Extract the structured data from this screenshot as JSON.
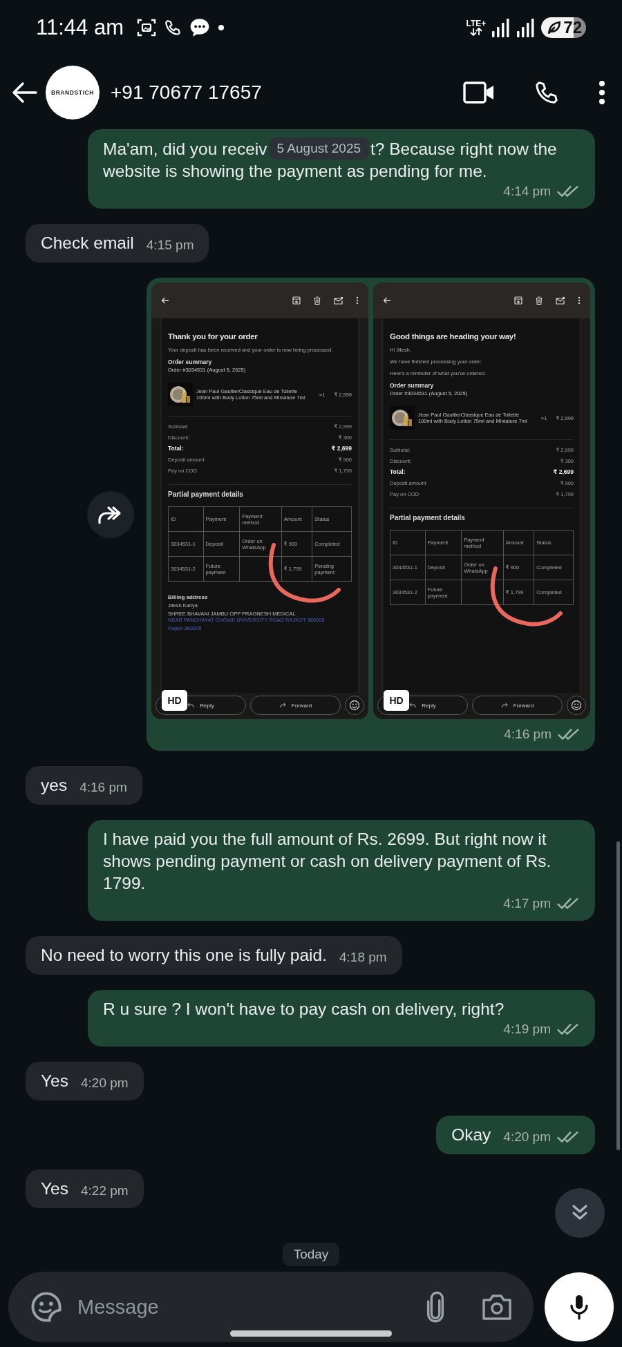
{
  "status_bar": {
    "time": "11:44 am",
    "network": "LTE+",
    "battery": "72"
  },
  "header": {
    "avatar_text": "BRANDSTICH",
    "contact": "+91 70677 17657"
  },
  "date_chip": "5 August 2025",
  "messages": [
    {
      "kind": "covered",
      "outgoing": true,
      "text_start": "Ma'am, did you receiv",
      "text_end": "t? Because right now the",
      "text_next": "website is showing the payment as pending for me.",
      "time": "4:14 pm",
      "delivered": true
    },
    {
      "kind": "text",
      "outgoing": false,
      "text": "Check email",
      "time": "4:15 pm"
    },
    {
      "kind": "images",
      "outgoing": true,
      "time": "4:16 pm",
      "delivered": true,
      "images": [
        {
          "title": "Thank you for your order",
          "intro": [
            "Your deposit has been received and your order is now being processed."
          ],
          "summary_heading": "Order summary",
          "order_line": "Order #3034531 (August 5, 2025)",
          "product": {
            "name": "Jean Paul GaultierClassique Eau de Toilette 100ml with Body Lotion 75ml and Miniature 7ml",
            "qty": "×1",
            "price": "₹ 2,999"
          },
          "totals": [
            {
              "label": "Subtotal:",
              "value": "₹ 2,999",
              "bold": false
            },
            {
              "label": "Discount:",
              "value": "₹ 300",
              "bold": false
            },
            {
              "label": "Total:",
              "value": "₹ 2,699",
              "bold": true
            },
            {
              "label": "Deposit amount",
              "value": "₹ 900",
              "bold": false
            },
            {
              "label": "Pay on COD",
              "value": "₹ 1,799",
              "bold": false
            }
          ],
          "partial_heading": "Partial payment details",
          "table": {
            "columns": [
              "ID",
              "Payment",
              "Payment method",
              "Amount",
              "Status"
            ],
            "rows": [
              [
                "3034531-1",
                "Deposit",
                "Order on WhatsApp",
                "₹ 900",
                "Completed"
              ],
              [
                "3034531-2",
                "Future payment",
                null,
                "₹ 1,799",
                "Pending payment"
              ]
            ]
          },
          "marked": true,
          "billing": {
            "heading": "Billing address",
            "name": "Jitesh Kariya",
            "address": "SHREE BHAVANI JAMBU OPP PRAGNESH MEDICAL",
            "address_link": "NEAR PANCHAYAT CHOWK UNIVERSITY ROAD RAJKOT 360005",
            "city_link": "Rajkot 360005"
          },
          "badge": "HD",
          "actions": [
            "Reply",
            "Forward"
          ]
        },
        {
          "title": "Good things are heading your way!",
          "intro": [
            "Hi Jitesh,",
            "We have finished processing your order.",
            "Here's a reminder of what you've ordered."
          ],
          "summary_heading": "Order summary",
          "order_line": "Order #3034531 (August 5, 2025)",
          "product": {
            "name": "Jean Paul GaultierClassique Eau de Toilette 100ml with Body Lotion 75ml and Miniature 7ml",
            "qty": "×1",
            "price": "₹ 2,999"
          },
          "totals": [
            {
              "label": "Subtotal:",
              "value": "₹ 2,999",
              "bold": false
            },
            {
              "label": "Discount:",
              "value": "₹ 300",
              "bold": false
            },
            {
              "label": "Total:",
              "value": "₹ 2,699",
              "bold": true
            },
            {
              "label": "Deposit amount",
              "value": "₹ 900",
              "bold": false
            },
            {
              "label": "Pay on COD",
              "value": "₹ 1,799",
              "bold": false
            }
          ],
          "partial_heading": "Partial payment details",
          "table": {
            "columns": [
              "ID",
              "Payment",
              "Payment method",
              "Amount",
              "Status"
            ],
            "rows": [
              [
                "3034531-1",
                "Deposit",
                "Order on WhatsApp",
                "₹ 900",
                "Completed"
              ],
              [
                "3034531-2",
                "Future payment",
                null,
                "₹ 1,799",
                "Completed"
              ]
            ]
          },
          "marked": true,
          "badge": "HD",
          "actions": [
            "Reply",
            "Forward"
          ]
        }
      ]
    },
    {
      "kind": "text",
      "outgoing": false,
      "text": "yes",
      "time": "4:16 pm"
    },
    {
      "kind": "text",
      "outgoing": true,
      "text": "I have paid you the full amount of Rs. 2699. But right now it shows pending payment or cash on delivery payment of Rs. 1799.",
      "time": "4:17 pm",
      "delivered": true
    },
    {
      "kind": "text",
      "outgoing": false,
      "text": "No need to worry this one is fully paid.",
      "time": "4:18 pm"
    },
    {
      "kind": "text",
      "outgoing": true,
      "text": "R u sure ? I won't have to pay cash on delivery, right?",
      "time": "4:19 pm",
      "delivered": true
    },
    {
      "kind": "text",
      "outgoing": false,
      "text": "Yes",
      "time": "4:20 pm"
    },
    {
      "kind": "text",
      "outgoing": true,
      "text": "Okay",
      "time": "4:20 pm",
      "delivered": true
    },
    {
      "kind": "text",
      "outgoing": false,
      "text": "Yes",
      "time": "4:22 pm"
    }
  ],
  "today_chip": "Today",
  "composer": {
    "placeholder": "Message"
  }
}
